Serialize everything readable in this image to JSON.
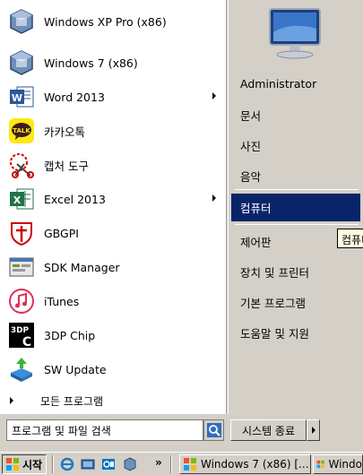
{
  "start_menu": {
    "programs": [
      {
        "label": "Windows XP Pro (x86)",
        "icon": "virtualbox-icon",
        "submenu": false
      },
      {
        "label": "Windows 7 (x86)",
        "icon": "virtualbox-icon",
        "submenu": false
      },
      {
        "label": "Word 2013",
        "icon": "word-icon",
        "submenu": true
      },
      {
        "label": "카카오톡",
        "icon": "kakaotalk-icon",
        "submenu": false
      },
      {
        "label": "캡처 도구",
        "icon": "snipping-tool-icon",
        "submenu": false
      },
      {
        "label": "Excel 2013",
        "icon": "excel-icon",
        "submenu": true
      },
      {
        "label": "GBGPI",
        "icon": "gbgpi-icon",
        "submenu": false
      },
      {
        "label": "SDK Manager",
        "icon": "sdk-manager-icon",
        "submenu": false
      },
      {
        "label": "iTunes",
        "icon": "itunes-icon",
        "submenu": false
      },
      {
        "label": "3DP Chip",
        "icon": "3dp-chip-icon",
        "submenu": false
      },
      {
        "label": "SW Update",
        "icon": "sw-update-icon",
        "submenu": false
      }
    ],
    "all_programs": "모든 프로그램",
    "kakao_badge": "TALK",
    "dp_badge": "3DP",
    "right_items": [
      {
        "label": "Administrator",
        "selected": false
      },
      {
        "label": "문서",
        "selected": false
      },
      {
        "label": "사진",
        "selected": false
      },
      {
        "label": "음악",
        "selected": false
      },
      {
        "label": "컴퓨터",
        "selected": true
      },
      {
        "label": "제어판",
        "selected": false
      },
      {
        "label": "장치 및 프린터",
        "selected": false
      },
      {
        "label": "기본 프로그램",
        "selected": false
      },
      {
        "label": "도움말 및 지원",
        "selected": false
      }
    ],
    "tooltip": "컴퓨터",
    "search_placeholder": "프로그램 및 파일 검색",
    "shutdown_label": "시스템 종료",
    "selection_color": "#0a246a"
  },
  "taskbar": {
    "start_label": "시작",
    "more_chevron": "»",
    "tasks": [
      {
        "label": "Windows 7 (x86) [..."
      },
      {
        "label": "Windo"
      }
    ]
  }
}
